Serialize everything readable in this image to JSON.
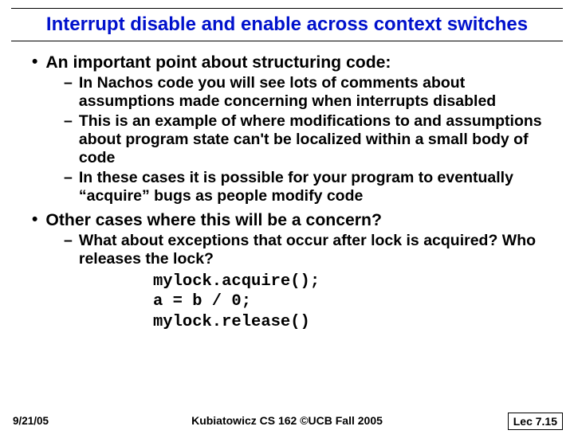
{
  "title": "Interrupt disable and enable across context switches",
  "bullets": [
    {
      "level": 1,
      "text": "An important point about structuring code:"
    },
    {
      "level": 2,
      "text": "In Nachos code you will see lots of comments about assumptions made concerning when interrupts disabled"
    },
    {
      "level": 2,
      "text": "This is an example of where modifications to and assumptions about program state can't be localized within a small body of code"
    },
    {
      "level": 2,
      "text": "In these cases it is possible for your program to eventually “acquire” bugs as people modify code"
    },
    {
      "level": 1,
      "text": "Other cases where this will be a concern?"
    },
    {
      "level": 2,
      "text": "What about exceptions that occur after lock is acquired?  Who releases the lock?"
    }
  ],
  "code": {
    "l1": "mylock.acquire();",
    "l2": "a = b / 0;",
    "l3": "mylock.release()"
  },
  "footer": {
    "date": "9/21/05",
    "center": "Kubiatowicz CS 162 ©UCB Fall 2005",
    "lec": "Lec 7.15"
  }
}
